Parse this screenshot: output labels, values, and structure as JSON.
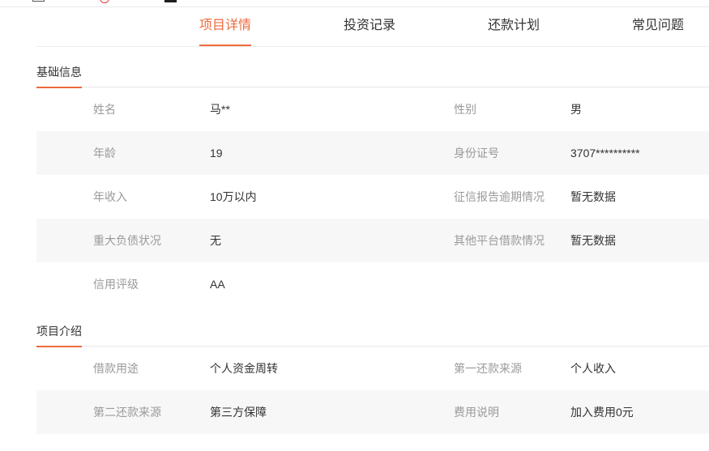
{
  "colors": {
    "accent": "#ee6a3c",
    "label": "#9a9a9a",
    "value": "#333333",
    "row_alt": "#f7f7f7"
  },
  "top_icons": [
    "document-icon",
    "circle-icon",
    "square-icon"
  ],
  "tabs": [
    {
      "label": "项目详情",
      "active": true
    },
    {
      "label": "投资记录",
      "active": false
    },
    {
      "label": "还款计划",
      "active": false
    },
    {
      "label": "常见问题",
      "active": false
    }
  ],
  "basic_info": {
    "title": "基础信息",
    "rows": [
      [
        {
          "label": "姓名",
          "value": "马**"
        },
        {
          "label": "性别",
          "value": "男"
        }
      ],
      [
        {
          "label": "年龄",
          "value": "19"
        },
        {
          "label": "身份证号",
          "value": "3707**********"
        }
      ],
      [
        {
          "label": "年收入",
          "value": "10万以内"
        },
        {
          "label": "征信报告逾期情况",
          "value": "暂无数据"
        }
      ],
      [
        {
          "label": "重大负债状况",
          "value": "无"
        },
        {
          "label": "其他平台借款情况",
          "value": "暂无数据"
        }
      ],
      [
        {
          "label": "信用评级",
          "value": "AA"
        }
      ]
    ]
  },
  "project_intro": {
    "title": "项目介绍",
    "rows": [
      [
        {
          "label": "借款用途",
          "value": "个人资金周转"
        },
        {
          "label": "第一还款来源",
          "value": "个人收入"
        }
      ],
      [
        {
          "label": "第二还款来源",
          "value": "第三方保障"
        },
        {
          "label": "费用说明",
          "value": "加入费用0元"
        }
      ]
    ]
  }
}
